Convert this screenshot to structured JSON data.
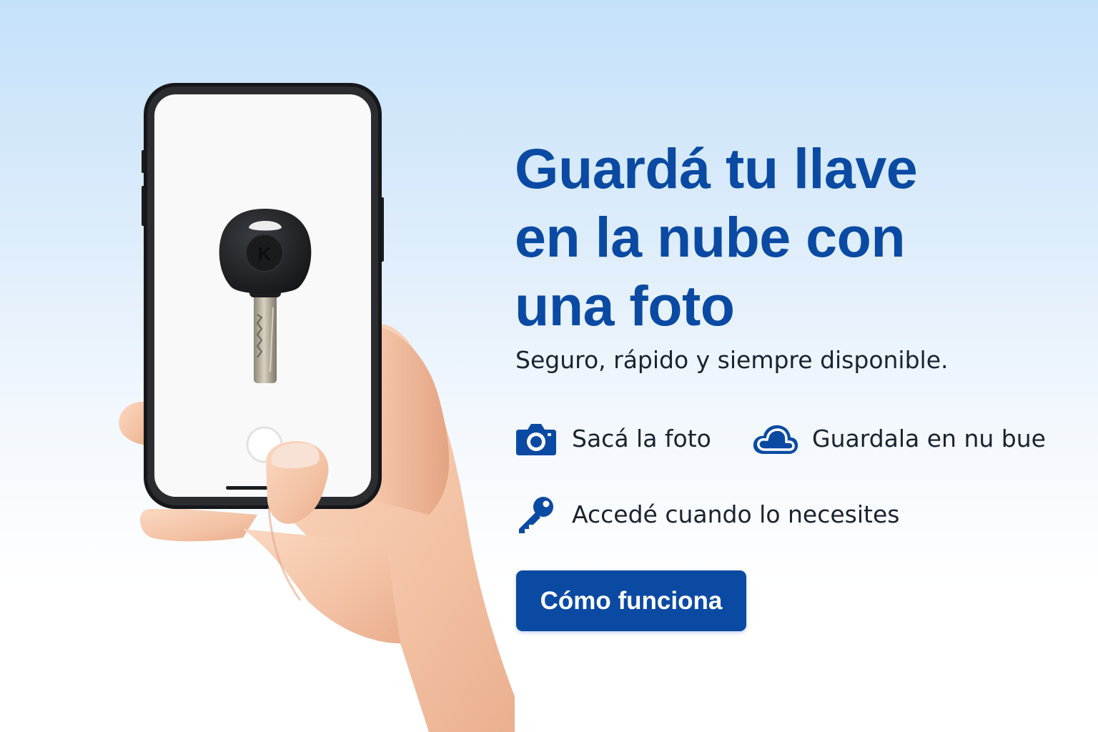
{
  "headline": {
    "line1": "Guardá tu llave",
    "line2": "en la nube con",
    "line3": "una foto"
  },
  "subtitle": "Seguro, rápido y siempre disponible.",
  "features": [
    {
      "icon": "camera-icon",
      "label": "Sacá la foto"
    },
    {
      "icon": "cloud-icon",
      "label": "Guardala en nu bue"
    },
    {
      "icon": "key-icon",
      "label": "Accedé cuando lo necesites"
    }
  ],
  "cta": {
    "label": "Cómo funciona"
  },
  "colors": {
    "brand_blue": "#0a4aa3",
    "text_dark": "#1b2230",
    "background_top": "#c4e1fa",
    "background_bottom": "#ffffff"
  }
}
